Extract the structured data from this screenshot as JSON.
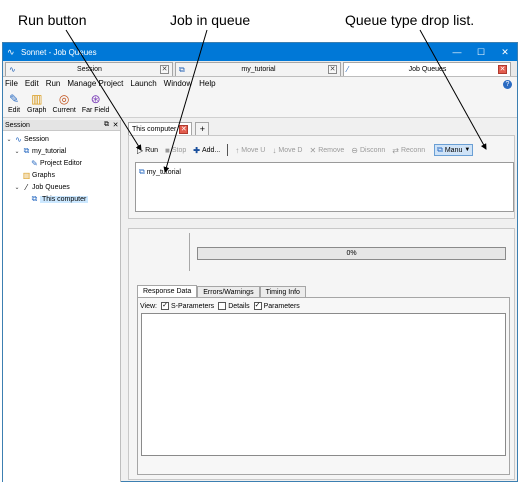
{
  "annotations": {
    "run_button": "Run button",
    "job_in_queue": "Job in queue",
    "queue_type": "Queue type drop list."
  },
  "window": {
    "title": "Sonnet - Job Queues",
    "controls": {
      "minimize": "—",
      "maximize": "☐",
      "close": "✕"
    }
  },
  "doc_tabs": [
    {
      "label": "Session",
      "icon": "session-icon"
    },
    {
      "label": "my_tutorial",
      "icon": "project-icon"
    },
    {
      "label": "Job Queues",
      "icon": "job-queues-icon"
    }
  ],
  "menu": [
    "File",
    "Edit",
    "Run",
    "Manage Project",
    "Launch",
    "Window",
    "Help"
  ],
  "toolbar": [
    {
      "label": "Edit",
      "icon": "edit-icon"
    },
    {
      "label": "Graph",
      "icon": "graph-icon"
    },
    {
      "label": "Current",
      "icon": "current-icon"
    },
    {
      "label": "Far Field",
      "icon": "far-field-icon"
    }
  ],
  "session_panel": {
    "title": "Session",
    "tree": [
      {
        "label": "Session",
        "level": 0,
        "twisty": "⌄"
      },
      {
        "label": "my_tutorial",
        "level": 1,
        "twisty": "⌄"
      },
      {
        "label": "Project Editor",
        "level": 2,
        "twisty": ""
      },
      {
        "label": "Graphs",
        "level": 1,
        "twisty": ""
      },
      {
        "label": "Job Queues",
        "level": 1,
        "twisty": "⌄"
      },
      {
        "label": "This computer",
        "level": 2,
        "twisty": "",
        "selected": true
      }
    ]
  },
  "inner_tabs": {
    "active": "This computer",
    "add": "+"
  },
  "queue_toolbar": {
    "run": "Run",
    "stop": "Stop",
    "add": "Add...",
    "move_up": "Move U",
    "move_down": "Move D",
    "remove": "Remove",
    "disconnect": "Disconn",
    "reconnect": "Reconn",
    "queue_type": "Manu"
  },
  "queue_jobs": [
    "my_tutorial"
  ],
  "progress": {
    "text": "0%",
    "value": 0
  },
  "result_tabs": [
    "Response Data",
    "Errors/Warnings",
    "Timing Info"
  ],
  "view_options": {
    "label": "View:",
    "items": [
      {
        "label": "S-Parameters",
        "checked": true
      },
      {
        "label": "Details",
        "checked": false
      },
      {
        "label": "Parameters",
        "checked": true
      }
    ]
  }
}
